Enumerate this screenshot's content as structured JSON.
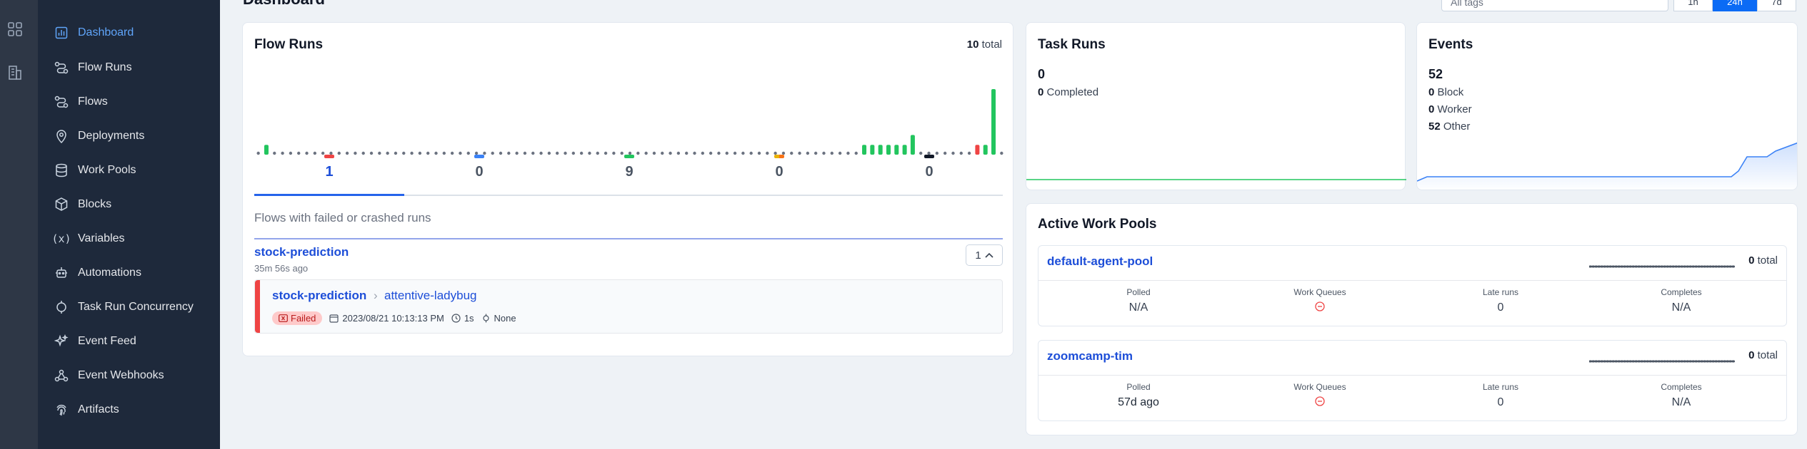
{
  "header": {
    "title": "Dashboard",
    "tag_placeholder": "All tags",
    "ranges": [
      "1h",
      "24h",
      "7d"
    ],
    "active_range": 1
  },
  "sidebar": {
    "items": [
      {
        "label": "Dashboard",
        "icon": "dashboard-icon",
        "active": true
      },
      {
        "label": "Flow Runs",
        "icon": "flow-runs-icon"
      },
      {
        "label": "Flows",
        "icon": "flows-icon"
      },
      {
        "label": "Deployments",
        "icon": "location-pin-icon"
      },
      {
        "label": "Work Pools",
        "icon": "database-icon"
      },
      {
        "label": "Blocks",
        "icon": "cube-icon"
      },
      {
        "label": "Variables",
        "icon": "variable-icon"
      },
      {
        "label": "Automations",
        "icon": "robot-icon"
      },
      {
        "label": "Task Run Concurrency",
        "icon": "concurrency-icon"
      },
      {
        "label": "Event Feed",
        "icon": "sparkles-icon"
      },
      {
        "label": "Event Webhooks",
        "icon": "webhook-icon"
      },
      {
        "label": "Artifacts",
        "icon": "fingerprint-icon"
      }
    ]
  },
  "flow_runs": {
    "title": "Flow Runs",
    "total_count": "10",
    "total_word": "total",
    "bar_heights": [
      0,
      0.15,
      0,
      0,
      0,
      0,
      0,
      0,
      0,
      0,
      0,
      0,
      0,
      0,
      0,
      0,
      0,
      0,
      0,
      0,
      0,
      0,
      0,
      0,
      0,
      0,
      0,
      0,
      0,
      0,
      0,
      0,
      0,
      0,
      0,
      0,
      0,
      0,
      0,
      0,
      0,
      0,
      0,
      0,
      0,
      0,
      0,
      0,
      0,
      0,
      0,
      0,
      0,
      0,
      0,
      0,
      0,
      0,
      0,
      0,
      0,
      0,
      0,
      0,
      0,
      0,
      0,
      0,
      0,
      0,
      0,
      0,
      0,
      0,
      0,
      0.15,
      0.15,
      0.15,
      0.15,
      0.15,
      0.15,
      0.3,
      0,
      0,
      0,
      0,
      0,
      0,
      0,
      0.15,
      0.15,
      1,
      0
    ],
    "bar_failed_index": 89,
    "states": [
      {
        "color": "#ef4444",
        "count": "1"
      },
      {
        "color": "#3b82f6",
        "count": "0"
      },
      {
        "color": "#22c55e",
        "count": "9"
      },
      {
        "color": "#eab308",
        "count": "0"
      },
      {
        "color": "#111827",
        "count": "0"
      }
    ],
    "failed_note": "Flows with failed or crashed runs",
    "flow": {
      "name": "stock-prediction",
      "ago": "35m 56s ago",
      "count": "1",
      "run": {
        "flow": "stock-prediction",
        "name": "attentive-ladybug",
        "state": "Failed",
        "time": "2023/08/21 10:13:13 PM",
        "duration": "1s",
        "tags": "None"
      }
    }
  },
  "task_runs": {
    "title": "Task Runs",
    "total": "0",
    "completed_count": "0",
    "completed_label": "Completed"
  },
  "events": {
    "title": "Events",
    "total": "52",
    "rows": [
      {
        "count": "0",
        "label": "Block"
      },
      {
        "count": "0",
        "label": "Worker"
      },
      {
        "count": "52",
        "label": "Other"
      }
    ]
  },
  "work_pools": {
    "title": "Active Work Pools",
    "pools": [
      {
        "name": "default-agent-pool",
        "total": "0",
        "total_word": "total",
        "polled": "N/A",
        "late_runs": "0",
        "completes": "N/A"
      },
      {
        "name": "zoomcamp-tim",
        "total": "0",
        "total_word": "total",
        "polled": "57d ago",
        "late_runs": "0",
        "completes": "N/A"
      }
    ],
    "labels": {
      "polled": "Polled",
      "work_queues": "Work Queues",
      "late_runs": "Late runs",
      "completes": "Completes"
    }
  },
  "colors": {
    "accent": "#2563eb",
    "sidebar": "#1e293b",
    "completed": "#22c55e",
    "failed": "#ef4444"
  }
}
